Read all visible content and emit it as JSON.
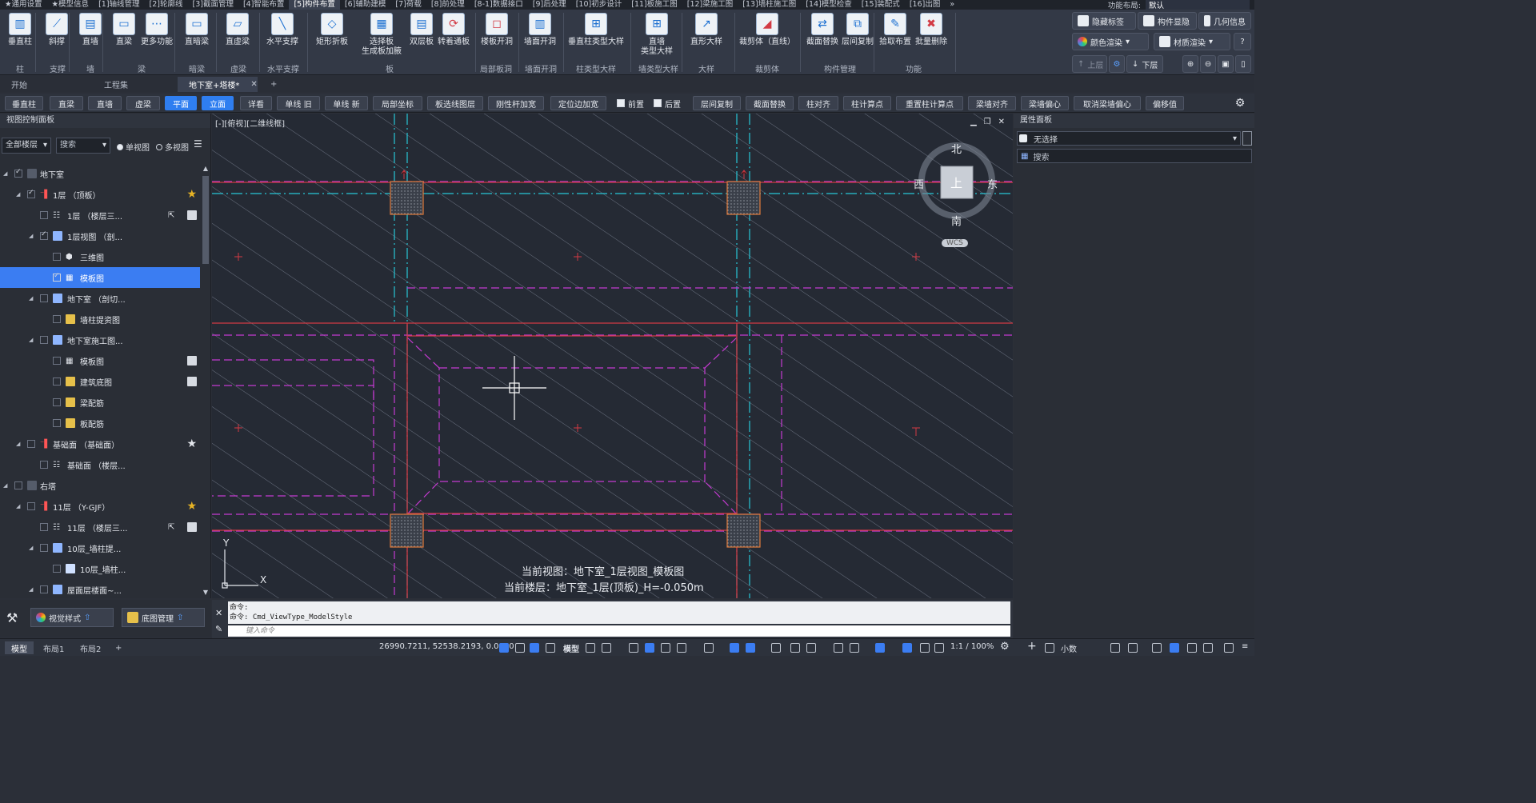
{
  "menu": {
    "tabs": [
      "★通用设置",
      "★模型信息",
      "[1]轴线管理",
      "[2]轮廓线",
      "[3]截面管理",
      "[4]智能布置",
      "[5]构件布置",
      "[6]辅助建模",
      "[7]荷载",
      "[8]前处理",
      "[8-1]数据接口",
      "[9]后处理",
      "[10]初步设计",
      "[11]板施工图",
      "[12]梁施工图",
      "[13]墙柱施工图",
      "[14]模型检查",
      "[15]装配式",
      "[16]出图"
    ],
    "active_index": 6,
    "overflow": "»",
    "layout_label": "功能布局:",
    "layout_value": "默认"
  },
  "ribbon": {
    "buttons": [
      "垂直柱",
      "斜撑",
      "直墙",
      "直梁",
      "更多功能",
      "直暗梁",
      "直虚梁",
      "水平支撑",
      "矩形折板",
      "选择板",
      "生成板加腋",
      "双层板",
      "转着通板",
      "楼板开洞",
      "墙面开洞",
      "垂直柱类型大样",
      "直墙",
      "类型大样",
      "直形大样",
      "裁剪体（直线）",
      "截面替换",
      "层间复制",
      "拾取布置",
      "批量删除"
    ],
    "groups": [
      "柱",
      "支撑",
      "墙",
      "梁",
      "暗梁",
      "虚梁",
      "水平支撑",
      "板",
      "局部板洞",
      "墙面开洞",
      "柱类型大样",
      "墙类型大样",
      "大样",
      "裁剪体",
      "构件管理",
      "功能"
    ],
    "right": {
      "hide_label": "隐藏标签",
      "component_show": "构件显隐",
      "geometry_info": "几何信息",
      "color_render": "颜色渲染",
      "material_render": "材质渲染",
      "floor_up": "上层",
      "floor_down": "下层"
    }
  },
  "doc_tabs": {
    "start": "开始",
    "project_set": "工程集",
    "current": "地下室+塔楼*",
    "add": "+"
  },
  "toolbar2": {
    "items": [
      "垂直柱",
      "直梁",
      "直墙",
      "虚梁",
      "平面",
      "立面",
      "详看",
      "单线 旧",
      "单线 新",
      "局部坐标",
      "板选线图层",
      "刚性杆加宽",
      "定位边加宽",
      "前置",
      "后置",
      "层间复制",
      "截面替换",
      "柱对齐",
      "柱计算点",
      "重置柱计算点",
      "梁墙对齐",
      "梁墙偏心",
      "取消梁墙偏心",
      "偏移值"
    ]
  },
  "left_panel": {
    "title": "视图控制面板",
    "floor_filter": "全部楼层",
    "search_placeholder": "搜索",
    "single_view": "单视图",
    "multi_view": "多视图",
    "tree": [
      {
        "label": "地下室"
      },
      {
        "label": "1层 （顶板）"
      },
      {
        "label": "1层 （楼层三..."
      },
      {
        "label": "1层视图 （剖..."
      },
      {
        "label": "三维图"
      },
      {
        "label": "模板图"
      },
      {
        "label": "地下室 （剖切..."
      },
      {
        "label": "墙柱提资图"
      },
      {
        "label": "地下室施工图..."
      },
      {
        "label": "模板图"
      },
      {
        "label": "建筑底图"
      },
      {
        "label": "梁配筋"
      },
      {
        "label": "板配筋"
      },
      {
        "label": "基础面 （基础面）"
      },
      {
        "label": "基础面 （楼层..."
      },
      {
        "label": "右塔"
      },
      {
        "label": "11层 （Y-GJF）"
      },
      {
        "label": "11层 （楼层三..."
      },
      {
        "label": "10层_墙柱提..."
      },
      {
        "label": "10层_墙柱..."
      },
      {
        "label": "屋面层楼面~..."
      }
    ],
    "bottom": {
      "visual_style": "视觉样式",
      "base_map": "底图管理"
    }
  },
  "canvas": {
    "viewport_label": "[-][俯视][二维线框]",
    "compass": {
      "north": "北",
      "south": "南",
      "east": "东",
      "west": "西",
      "top": "上",
      "wcs": "WCS"
    },
    "ucs_x": "X",
    "ucs_y": "Y",
    "info_view": "当前视图：地下室_1层视图_模板图",
    "info_floor": "当前楼层：地下室_1层(顶板)_H=-0.050m"
  },
  "right_panel": {
    "title": "属性面板",
    "selection": "无选择",
    "search_placeholder": "搜索"
  },
  "command": {
    "line1": "命令:",
    "line2": "命令: Cmd_ViewType_ModelStyle",
    "input_placeholder": "键入命令"
  },
  "status": {
    "tabs": [
      "模型",
      "布局1",
      "布局2"
    ],
    "add": "+",
    "coords": "26990.7211, 52538.2193, 0.0000",
    "model": "模型",
    "scale": "1:1 / 100%",
    "units": "小数"
  },
  "colors": {
    "canvas_bg": "#252a34",
    "accent": "#3b7df2",
    "axis_cyan": "#27c6d6",
    "beam_magenta": "#c43ad0",
    "slab_red": "#d23a44"
  }
}
